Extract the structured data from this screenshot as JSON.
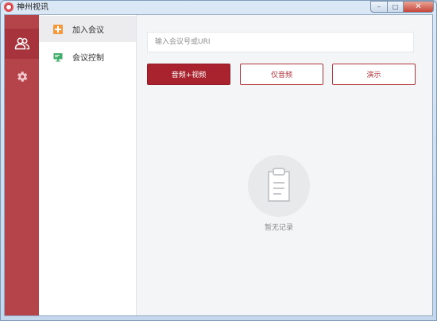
{
  "window": {
    "title": "神州视讯",
    "controls": {
      "minimize": "–",
      "maximize": "□",
      "close": "✕"
    }
  },
  "rail": {
    "items": [
      {
        "icon": "contacts-icon",
        "active": true
      },
      {
        "icon": "gear-icon",
        "active": false
      }
    ],
    "active_color": "#a7343c",
    "color": "#b5434a"
  },
  "menu": {
    "items": [
      {
        "label": "加入会议",
        "icon": "plus-icon",
        "active": true
      },
      {
        "label": "会议控制",
        "icon": "monitor-icon",
        "active": false
      }
    ]
  },
  "main": {
    "search": {
      "placeholder": "输入会议号或URI",
      "value": ""
    },
    "buttons": {
      "audio_video": "音频+视频",
      "audio_only": "仅音频",
      "presentation": "演示"
    },
    "empty_state": {
      "icon": "clipboard-icon",
      "text": "暂无记录"
    }
  },
  "colors": {
    "accent": "#a8232e",
    "outline": "#b2353d",
    "background": "#f4f5f7"
  }
}
